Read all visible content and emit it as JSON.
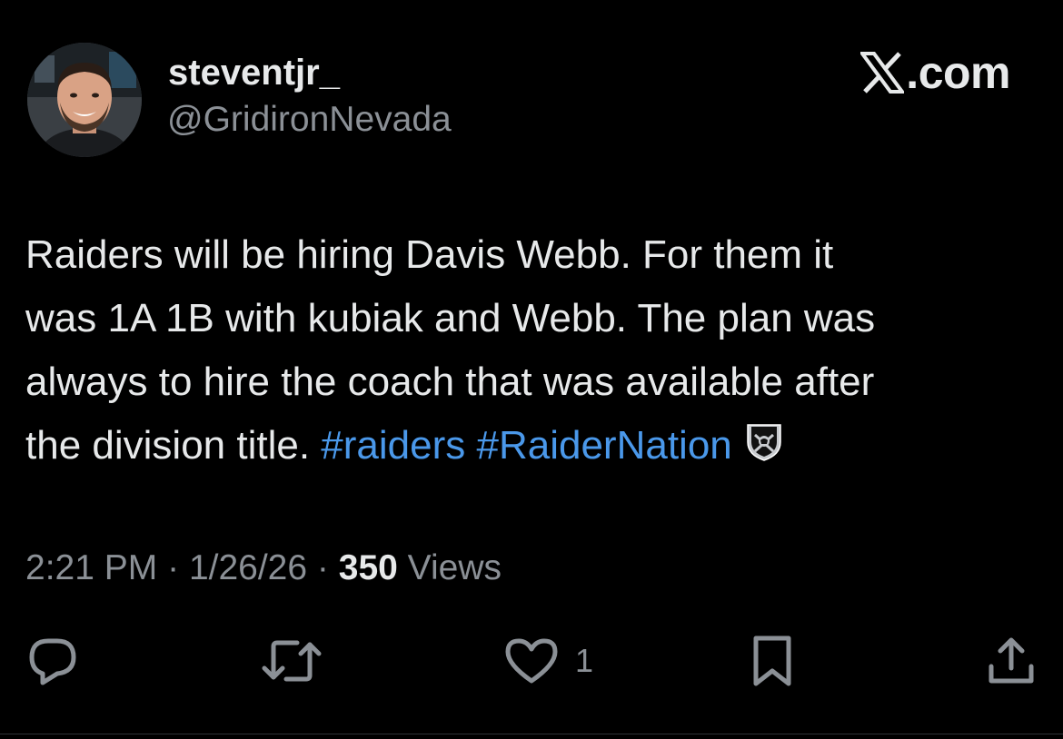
{
  "author": {
    "display_name": "steventjr_",
    "handle": "@GridironNevada",
    "avatar": "profile-photo"
  },
  "brand": {
    "logo_icon": "x-logo-icon",
    "suffix": ".com"
  },
  "tweet": {
    "lines": [
      {
        "text": "Raiders will be hiring Davis Webb. For them it"
      },
      {
        "text": "was 1A 1B with kubiak and Webb. The plan was"
      },
      {
        "text": "always to hire the coach that was available after"
      },
      {
        "text": "the division title. ",
        "hashtags": [
          "#raiders",
          "#RaiderNation"
        ],
        "emoji": "raiders-shield-emoji"
      }
    ]
  },
  "meta": {
    "time": "2:21 PM",
    "separator": "·",
    "date": "1/26/26",
    "views_count": "350",
    "views_label": "Views"
  },
  "actions": {
    "reply_icon": "reply-bubble-icon",
    "retweet_icon": "retweet-icon",
    "like_icon": "heart-icon",
    "like_count": "1",
    "bookmark_icon": "bookmark-icon",
    "share_icon": "share-icon"
  },
  "colors": {
    "background": "#000000",
    "primary_text": "#e7e9ea",
    "secondary_text": "#8b9096",
    "hashtag": "#4a98ea"
  }
}
